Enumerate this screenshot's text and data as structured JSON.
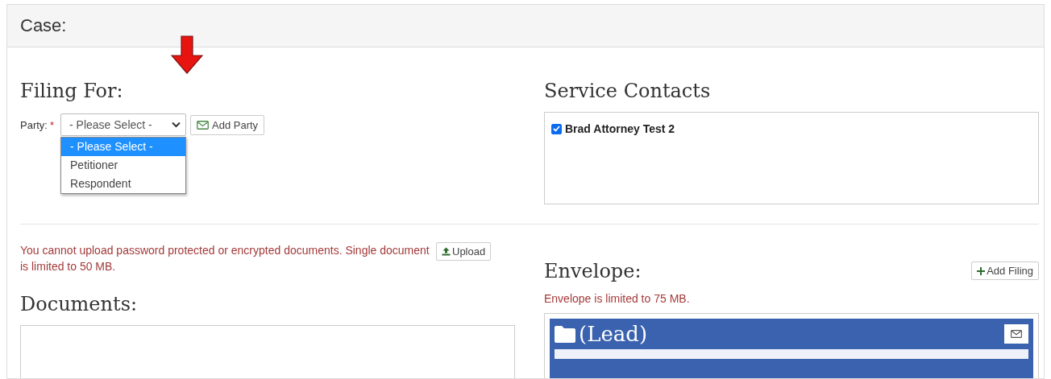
{
  "panel": {
    "title": "Case:"
  },
  "filing_for": {
    "heading": "Filing For:",
    "party_label": "Party:",
    "required_mark": "*",
    "select_value": "- Please Select -",
    "dropdown_open": true,
    "options": [
      {
        "label": "- Please Select -",
        "selected": true
      },
      {
        "label": "Petitioner",
        "selected": false
      },
      {
        "label": "Respondent",
        "selected": false
      }
    ],
    "add_party_button": "Add Party"
  },
  "service_contacts": {
    "heading": "Service Contacts",
    "contacts": [
      {
        "name": "Brad Attorney Test 2",
        "checked": true
      }
    ]
  },
  "documents": {
    "warning": "You cannot upload password protected or encrypted documents. Single document is limited to 50 MB.",
    "upload_button": "Upload",
    "heading": "Documents:"
  },
  "envelope": {
    "heading": "Envelope:",
    "add_filing_button": "Add Filing",
    "warning": "Envelope is limited to 75 MB.",
    "filings": [
      {
        "title": "(Lead)"
      }
    ]
  }
}
